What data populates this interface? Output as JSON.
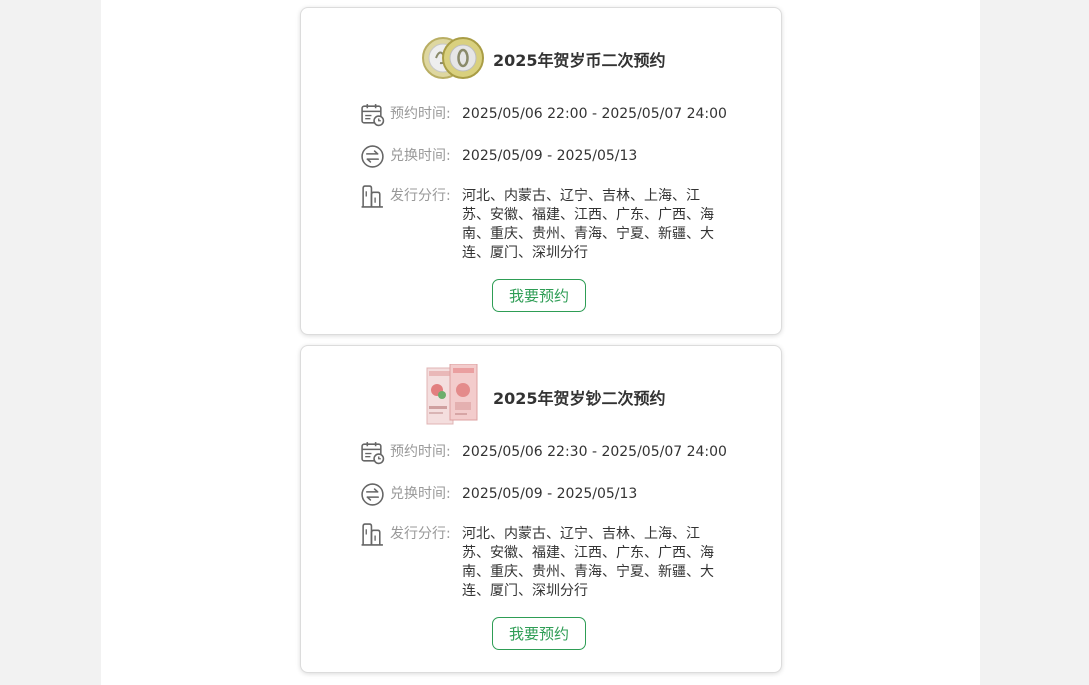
{
  "colors": {
    "accent": "#2e9d55",
    "label": "#999999",
    "text": "#333333"
  },
  "cards": [
    {
      "image": "coin-image",
      "title": "2025年贺岁币二次预约",
      "reserve_label": "预约时间:",
      "reserve_value": "2025/05/06 22:00 - 2025/05/07 24:00",
      "exchange_label": "兑换时间:",
      "exchange_value": "2025/05/09 - 2025/05/13",
      "branch_label": "发行分行:",
      "branch_value": "河北、内蒙古、辽宁、吉林、上海、江苏、安徽、福建、江西、广东、广西、海南、重庆、贵州、青海、宁夏、新疆、大连、厦门、深圳分行",
      "button_label": "我要预约"
    },
    {
      "image": "banknote-image",
      "title": "2025年贺岁钞二次预约",
      "reserve_label": "预约时间:",
      "reserve_value": "2025/05/06 22:30 - 2025/05/07 24:00",
      "exchange_label": "兑换时间:",
      "exchange_value": "2025/05/09 - 2025/05/13",
      "branch_label": "发行分行:",
      "branch_value": "河北、内蒙古、辽宁、吉林、上海、江苏、安徽、福建、江西、广东、广西、海南、重庆、贵州、青海、宁夏、新疆、大连、厦门、深圳分行",
      "button_label": "我要预约"
    }
  ]
}
